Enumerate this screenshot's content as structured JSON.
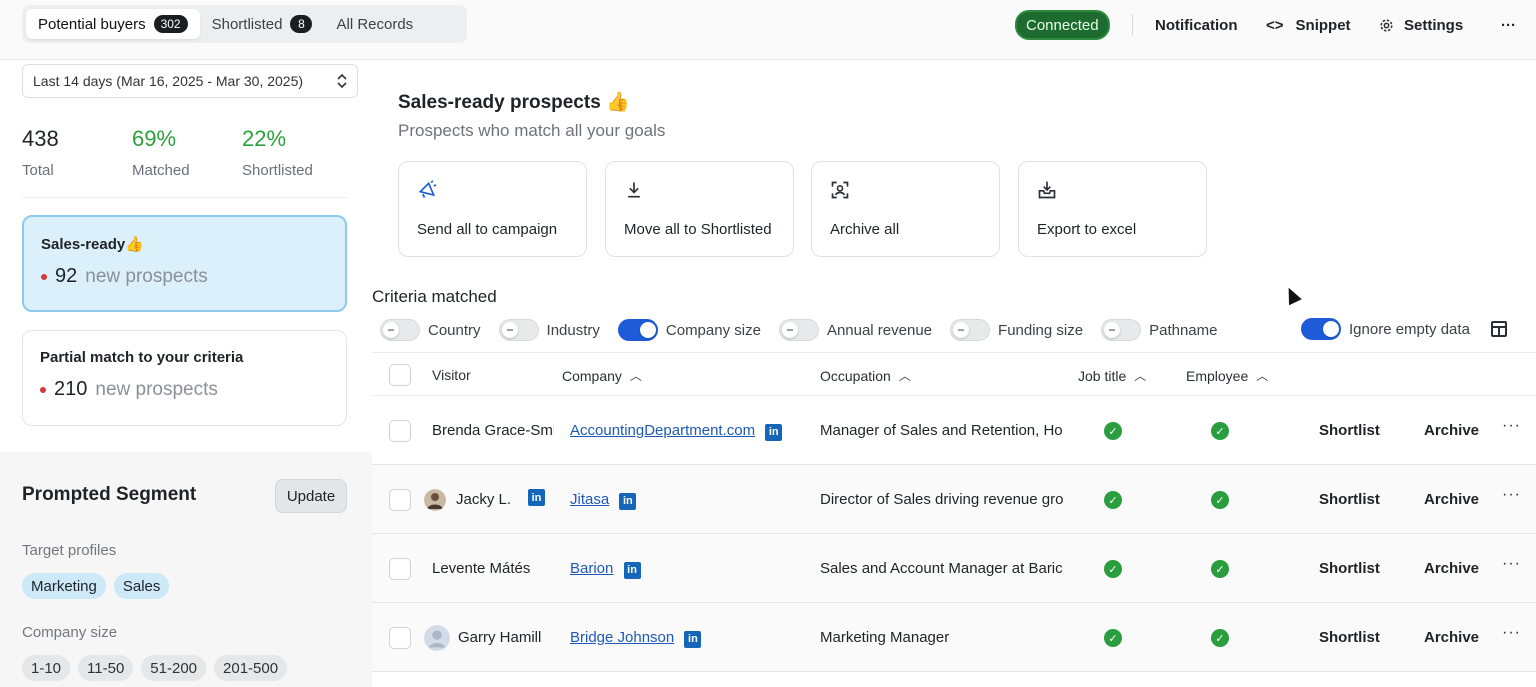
{
  "tabs": [
    {
      "label": "Potential buyers",
      "count": "302"
    },
    {
      "label": "Shortlisted",
      "count": "8"
    },
    {
      "label": "All Records"
    }
  ],
  "topbar": {
    "status": "Connected",
    "notification": "Notification",
    "snippet_icon": "<>",
    "snippet": "Snippet",
    "settings": "Settings",
    "more": "···"
  },
  "colors": {
    "accent": "#1d5bd8",
    "connected": "#1e6b2f",
    "positive": "#2aa13a",
    "selected_card": "#dcf0fb"
  },
  "sidebar": {
    "date_range": "Last 14 days (Mar 16, 2025 - Mar 30, 2025)",
    "stats": [
      {
        "value": "438",
        "label": "Total"
      },
      {
        "value": "69%",
        "label": "Matched"
      },
      {
        "value": "22%",
        "label": "Shortlisted"
      }
    ],
    "cards": [
      {
        "title": "Sales-ready👍",
        "count": "92",
        "text": "new prospects"
      },
      {
        "title": "Partial match to your criteria",
        "count": "210",
        "text": "new prospects"
      }
    ],
    "segment": {
      "title": "Prompted Segment",
      "update": "Update",
      "target_label": "Target profiles",
      "targets": [
        "Marketing",
        "Sales"
      ],
      "size_label": "Company size",
      "sizes": [
        "1-10",
        "11-50",
        "51-200",
        "201-500"
      ]
    }
  },
  "main": {
    "title": "Sales-ready prospects 👍",
    "subtitle": "Prospects who match all your goals",
    "actions": [
      {
        "label": "Send all to campaign",
        "icon": "megaphone-icon"
      },
      {
        "label": "Move all to Shortlisted",
        "icon": "download-icon"
      },
      {
        "label": "Archive all",
        "icon": "scan-user-icon"
      },
      {
        "label": "Export to excel",
        "icon": "export-tray-icon"
      }
    ],
    "criteria_title": "Criteria matched",
    "criteria": [
      {
        "label": "Country",
        "on": false
      },
      {
        "label": "Industry",
        "on": false
      },
      {
        "label": "Company size",
        "on": true
      },
      {
        "label": "Annual revenue",
        "on": false
      },
      {
        "label": "Funding size",
        "on": false
      },
      {
        "label": "Pathname",
        "on": false
      }
    ],
    "ignore_empty": {
      "label": "Ignore empty data",
      "on": true
    }
  },
  "table": {
    "columns": [
      "Visitor",
      "Company",
      "Occupation",
      "Job title",
      "Employee"
    ],
    "row_actions": {
      "shortlist": "Shortlist",
      "archive": "Archive"
    },
    "rows": [
      {
        "visitor": "Brenda Grace-Smith",
        "company": "AccountingDepartment.com",
        "occupation": "Manager of Sales and Retention, Ho",
        "job_title_match": true,
        "employee_match": true
      },
      {
        "visitor": "Jacky L.",
        "company": "Jitasa",
        "occupation": "Director of Sales driving revenue gro",
        "job_title_match": true,
        "employee_match": true
      },
      {
        "visitor": "Levente Mátés",
        "company": "Barion",
        "occupation": "Sales and Account Manager at Baric",
        "job_title_match": true,
        "employee_match": true
      },
      {
        "visitor": "Garry Hamill",
        "company": "Bridge Johnson",
        "occupation": "Marketing Manager",
        "job_title_match": true,
        "employee_match": true
      }
    ]
  }
}
